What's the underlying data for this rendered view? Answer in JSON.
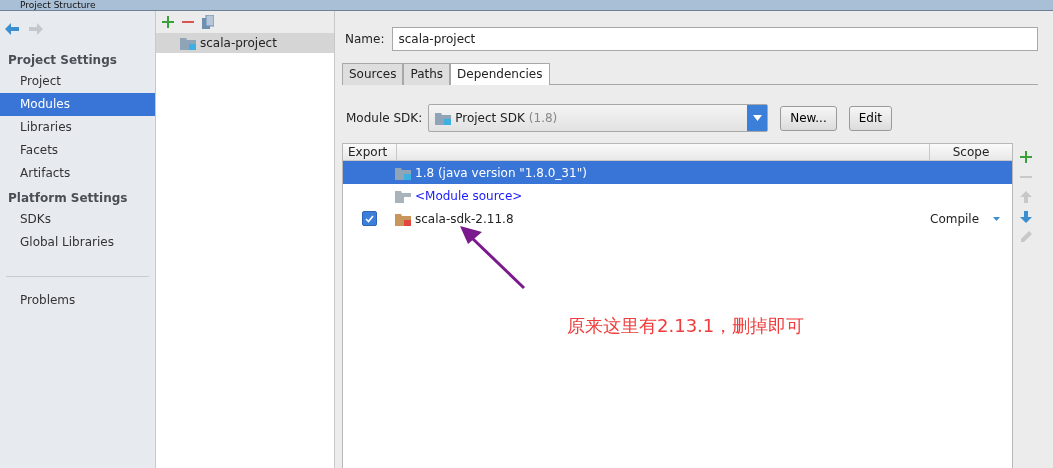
{
  "window": {
    "title": "Project Structure"
  },
  "sidebar": {
    "sections": [
      {
        "title": "Project Settings",
        "items": [
          {
            "label": "Project",
            "selected": false
          },
          {
            "label": "Modules",
            "selected": true
          },
          {
            "label": "Libraries",
            "selected": false
          },
          {
            "label": "Facets",
            "selected": false
          },
          {
            "label": "Artifacts",
            "selected": false
          }
        ]
      },
      {
        "title": "Platform Settings",
        "items": [
          {
            "label": "SDKs",
            "selected": false
          },
          {
            "label": "Global Libraries",
            "selected": false
          }
        ]
      }
    ],
    "bottom_items": [
      {
        "label": "Problems",
        "selected": false
      }
    ]
  },
  "modules": {
    "items": [
      {
        "label": "scala-project",
        "selected": true
      }
    ]
  },
  "name_field": {
    "label": "Name:",
    "value": "scala-project"
  },
  "tabs": [
    {
      "label": "Sources",
      "selected": false
    },
    {
      "label": "Paths",
      "selected": false
    },
    {
      "label": "Dependencies",
      "selected": true
    }
  ],
  "module_sdk": {
    "label": "Module SDK:",
    "value": "Project SDK",
    "hint": "(1.8)",
    "buttons": [
      "New...",
      "Edit"
    ]
  },
  "table": {
    "columns": [
      "Export",
      "Scope"
    ],
    "rows": [
      {
        "kind": "sdk",
        "name": "1.8 (java version \"1.8.0_31\")",
        "selected": true
      },
      {
        "kind": "source",
        "name": "<Module source>",
        "selected": false
      },
      {
        "kind": "library",
        "name": "scala-sdk-2.11.8",
        "selected": false,
        "checked": true,
        "scope": "Compile"
      }
    ]
  },
  "annotation": {
    "text": "原来这里有2.13.1，删掉即可"
  }
}
